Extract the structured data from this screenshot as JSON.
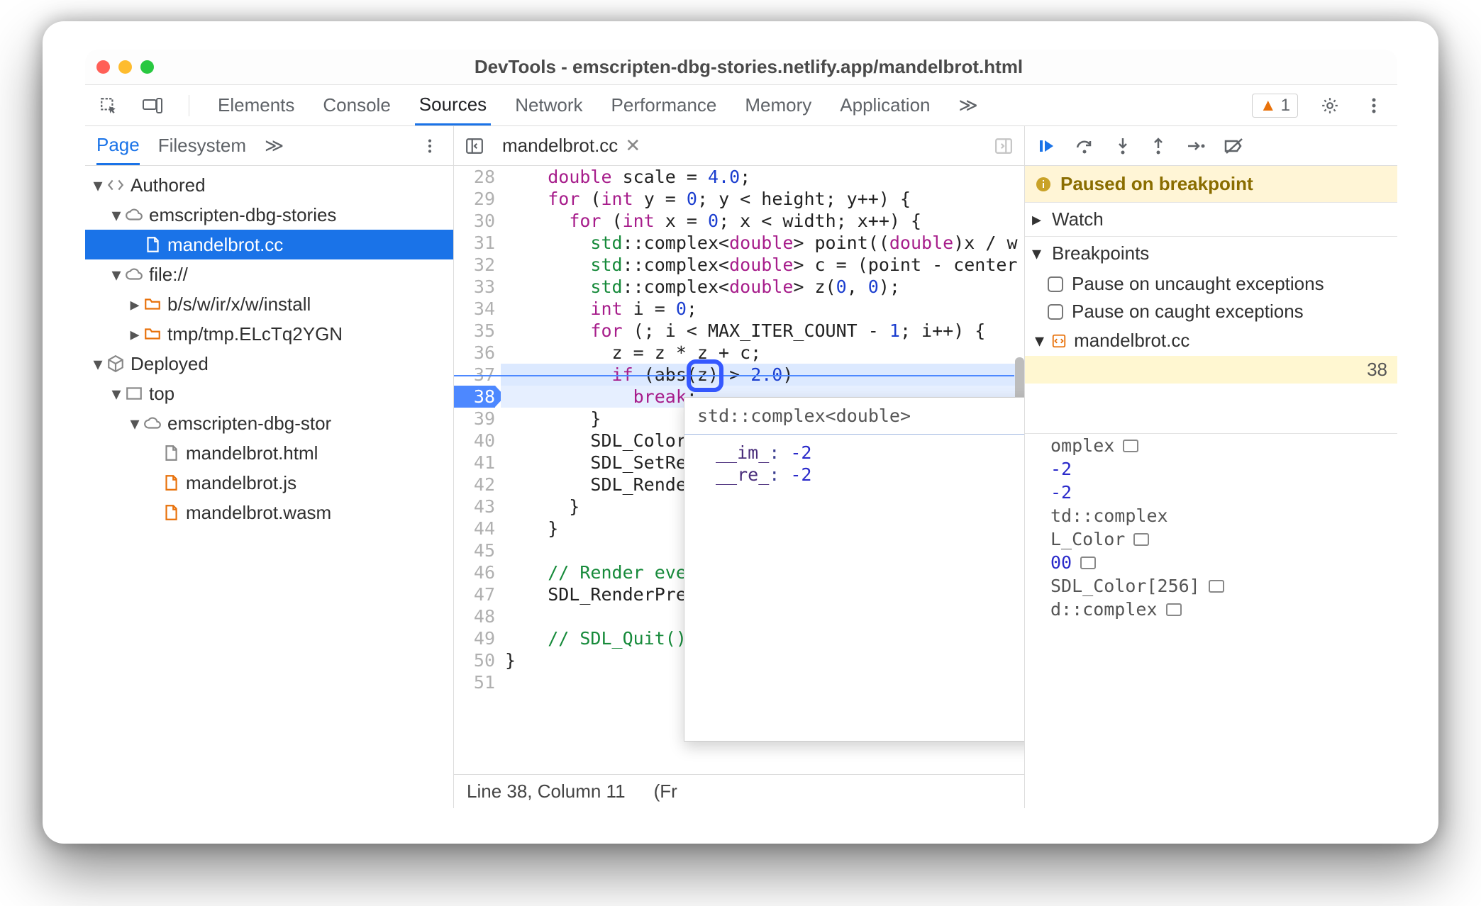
{
  "window": {
    "title": "DevTools - emscripten-dbg-stories.netlify.app/mandelbrot.html"
  },
  "maintabs": {
    "items": [
      "Elements",
      "Console",
      "Sources",
      "Network",
      "Performance",
      "Memory",
      "Application"
    ],
    "active": "Sources",
    "overflow": "≫",
    "warning_count": "1"
  },
  "left": {
    "tabs": [
      "Page",
      "Filesystem"
    ],
    "active": "Page",
    "overflow": "≫",
    "tree": [
      {
        "indent": 0,
        "tw": "open",
        "icon": "angle",
        "label": "Authored"
      },
      {
        "indent": 1,
        "tw": "open",
        "icon": "cloud",
        "label": "emscripten-dbg-stories"
      },
      {
        "indent": 2,
        "tw": "none",
        "icon": "file-g",
        "label": "mandelbrot.cc",
        "selected": true
      },
      {
        "indent": 1,
        "tw": "open",
        "icon": "cloud",
        "label": "file://"
      },
      {
        "indent": 2,
        "tw": "closed",
        "icon": "folder-o",
        "label": "b/s/w/ir/x/w/install"
      },
      {
        "indent": 2,
        "tw": "closed",
        "icon": "folder-o",
        "label": "tmp/tmp.ELcTq2YGN"
      },
      {
        "indent": 0,
        "tw": "open",
        "icon": "cube",
        "label": "Deployed"
      },
      {
        "indent": 1,
        "tw": "open",
        "icon": "frame",
        "label": "top"
      },
      {
        "indent": 2,
        "tw": "open",
        "icon": "cloud",
        "label": "emscripten-dbg-stor"
      },
      {
        "indent": 3,
        "tw": "none",
        "icon": "file-g",
        "label": "mandelbrot.html"
      },
      {
        "indent": 3,
        "tw": "none",
        "icon": "file-o",
        "label": "mandelbrot.js"
      },
      {
        "indent": 3,
        "tw": "none",
        "icon": "file-o",
        "label": "mandelbrot.wasm"
      }
    ]
  },
  "editor": {
    "filename": "mandelbrot.cc",
    "status_line": "Line 38, Column 11",
    "status_right": "(Fr",
    "exec_line": 38,
    "lines": [
      {
        "n": 28,
        "html": "    <span class='ty'>double</span> scale = <span class='num'>4.0</span>;"
      },
      {
        "n": 29,
        "html": "    <span class='kw'>for</span> (<span class='ty'>int</span> y = <span class='num'>0</span>; y &lt; height; y++) {"
      },
      {
        "n": 30,
        "html": "      <span class='kw'>for</span> (<span class='ty'>int</span> x = <span class='num'>0</span>; x &lt; width; x++) {"
      },
      {
        "n": 31,
        "html": "        <span class='std'>std</span>::complex&lt;<span class='ty'>double</span>&gt; point((<span class='ty'>double</span>)x / w"
      },
      {
        "n": 32,
        "html": "        <span class='std'>std</span>::complex&lt;<span class='ty'>double</span>&gt; c = (point - center"
      },
      {
        "n": 33,
        "html": "        <span class='std'>std</span>::complex&lt;<span class='ty'>double</span>&gt; z(<span class='num'>0</span>, <span class='num'>0</span>);"
      },
      {
        "n": 34,
        "html": "        <span class='ty'>int</span> i = <span class='num'>0</span>;"
      },
      {
        "n": 35,
        "html": "        <span class='kw'>for</span> (; i &lt; MAX_ITER_COUNT - <span class='num'>1</span>; i++) {"
      },
      {
        "n": 36,
        "html": "          z = z * z + c;"
      },
      {
        "n": 37,
        "html": "          <span class='kw'>if</span> (abs(z) &gt; <span class='num'>2.0</span>)"
      },
      {
        "n": 38,
        "html": "            <span class='kw'>break</span>;"
      },
      {
        "n": 39,
        "html": "        }"
      },
      {
        "n": 40,
        "html": "        SDL_Color"
      },
      {
        "n": 41,
        "html": "        SDL_SetRe"
      },
      {
        "n": 42,
        "html": "        SDL_Rende"
      },
      {
        "n": 43,
        "html": "      }"
      },
      {
        "n": 44,
        "html": "    }"
      },
      {
        "n": 45,
        "html": ""
      },
      {
        "n": 46,
        "html": "    <span class='cm'>// Render eve</span>"
      },
      {
        "n": 47,
        "html": "    SDL_RenderPre"
      },
      {
        "n": 48,
        "html": ""
      },
      {
        "n": 49,
        "html": "    <span class='cm'>// SDL_Quit()</span>"
      },
      {
        "n": 50,
        "html": "}"
      },
      {
        "n": 51,
        "html": ""
      }
    ]
  },
  "tooltip": {
    "title": "std::complex<double>",
    "fields": [
      {
        "k": "__im_",
        "v": "-2"
      },
      {
        "k": "__re_",
        "v": "-2"
      }
    ]
  },
  "right": {
    "banner": "Paused on breakpoint",
    "watch": "Watch",
    "breakpoints": {
      "title": "Breakpoints",
      "uncaught": "Pause on uncaught exceptions",
      "caught": "Pause on caught exceptions",
      "file": "mandelbrot.cc",
      "line": "38"
    },
    "scope_items": [
      {
        "k": "",
        "v": "omplex<double>",
        "mem": true,
        "obj": true
      },
      {
        "k": "",
        "v": "-2"
      },
      {
        "k": "",
        "v": "-2"
      },
      {
        "k": "",
        "v": "td::complex<double>",
        "obj": true
      },
      {
        "k": "",
        "v": "L_Color",
        "mem": true,
        "obj": true
      },
      {
        "k": "",
        "v": "00",
        "mem": true
      },
      {
        "k": "",
        "v": "SDL_Color[256]",
        "mem": true,
        "obj": true
      },
      {
        "k": "",
        "v": "d::complex<double>",
        "mem": true,
        "obj": true
      }
    ]
  }
}
